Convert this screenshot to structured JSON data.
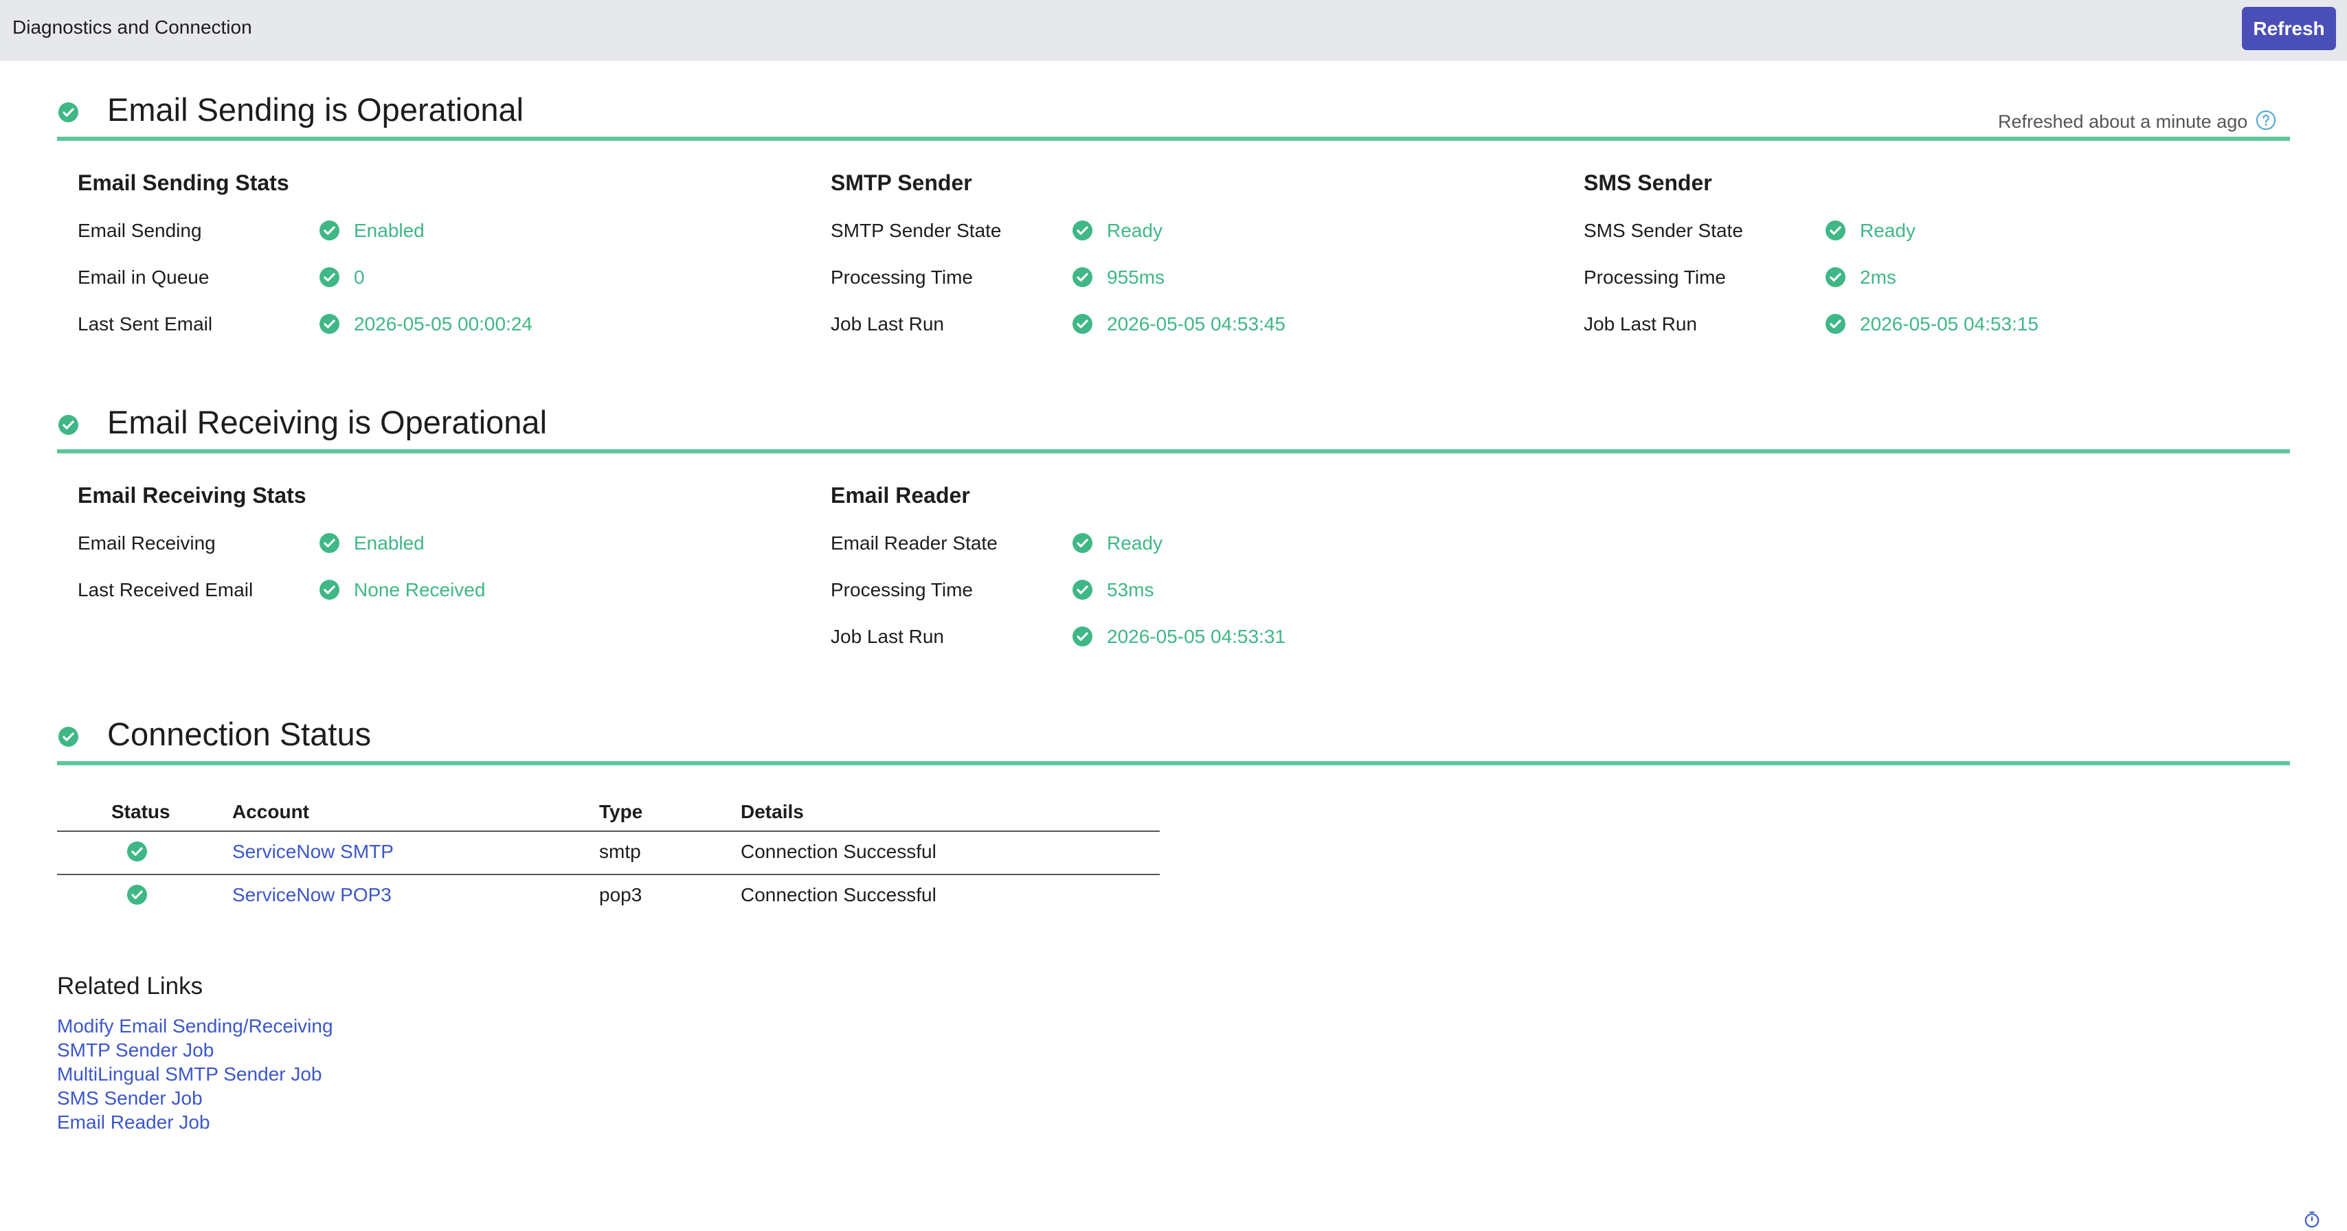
{
  "header": {
    "title": "Diagnostics and Connection",
    "refresh_label": "Refresh"
  },
  "refreshed_text": "Refreshed about a minute ago",
  "colors": {
    "accent": "#5fc69a",
    "ok": "#3fb786",
    "link": "#3c57c8",
    "button": "#4a4fb8"
  },
  "icons": {
    "status": "check-circle-icon",
    "help": "question-circle-icon",
    "timer": "timer-icon"
  },
  "sending": {
    "title": "Email Sending is Operational",
    "stats": {
      "title": "Email Sending Stats",
      "rows": [
        {
          "label": "Email Sending",
          "value": "Enabled"
        },
        {
          "label": "Email in Queue",
          "value": "0"
        },
        {
          "label": "Last Sent Email",
          "value": "2026-05-05 00:00:24"
        }
      ]
    },
    "smtp": {
      "title": "SMTP Sender",
      "rows": [
        {
          "label": "SMTP Sender State",
          "value": "Ready"
        },
        {
          "label": "Processing Time",
          "value": "955ms"
        },
        {
          "label": "Job Last Run",
          "value": "2026-05-05 04:53:45"
        }
      ]
    },
    "sms": {
      "title": "SMS Sender",
      "rows": [
        {
          "label": "SMS Sender State",
          "value": "Ready"
        },
        {
          "label": "Processing Time",
          "value": "2ms"
        },
        {
          "label": "Job Last Run",
          "value": "2026-05-05 04:53:15"
        }
      ]
    }
  },
  "receiving": {
    "title": "Email Receiving is Operational",
    "stats": {
      "title": "Email Receiving Stats",
      "rows": [
        {
          "label": "Email Receiving",
          "value": "Enabled"
        },
        {
          "label": "Last Received Email",
          "value": "None Received"
        }
      ]
    },
    "reader": {
      "title": "Email Reader",
      "rows": [
        {
          "label": "Email Reader State",
          "value": "Ready"
        },
        {
          "label": "Processing Time",
          "value": "53ms"
        },
        {
          "label": "Job Last Run",
          "value": "2026-05-05 04:53:31"
        }
      ]
    }
  },
  "connection": {
    "title": "Connection Status",
    "headers": {
      "status": "Status",
      "account": "Account",
      "type": "Type",
      "details": "Details"
    },
    "rows": [
      {
        "account": "ServiceNow SMTP",
        "type": "smtp",
        "details": "Connection Successful"
      },
      {
        "account": "ServiceNow POP3",
        "type": "pop3",
        "details": "Connection Successful"
      }
    ]
  },
  "related": {
    "title": "Related Links",
    "links": [
      "Modify Email Sending/Receiving",
      "SMTP Sender Job",
      "MultiLingual SMTP Sender Job",
      "SMS Sender Job",
      "Email Reader Job"
    ]
  }
}
